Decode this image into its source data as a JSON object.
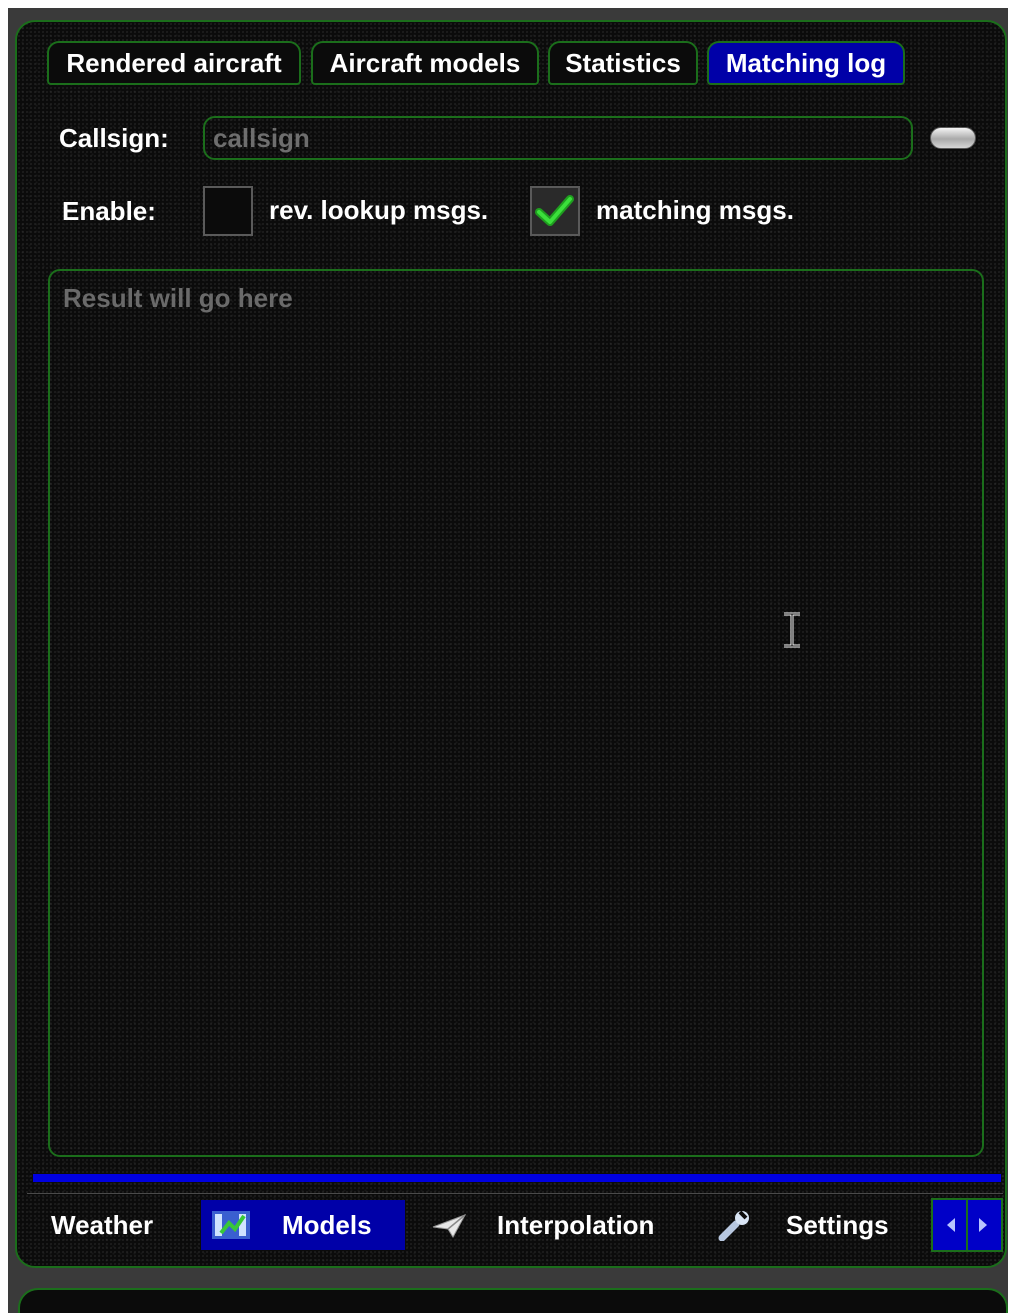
{
  "tabs": [
    {
      "label": "Rendered aircraft",
      "active": false
    },
    {
      "label": "Aircraft models",
      "active": false
    },
    {
      "label": "Statistics",
      "active": false
    },
    {
      "label": "Matching log",
      "active": true
    }
  ],
  "callsign": {
    "label": "Callsign:",
    "value": "",
    "placeholder": "callsign"
  },
  "enable": {
    "label": "Enable:",
    "options": [
      {
        "label": "rev. lookup msgs.",
        "checked": false
      },
      {
        "label": "matching msgs.",
        "checked": true
      }
    ]
  },
  "result": {
    "value": "",
    "placeholder": "Result will go here"
  },
  "bottom_nav": {
    "items": [
      {
        "label": "Weather",
        "icon": "none",
        "active": false
      },
      {
        "label": "Models",
        "icon": "models-icon",
        "active": true
      },
      {
        "label": "Interpolation",
        "icon": "paper-plane-icon",
        "active": false
      },
      {
        "label": "Settings",
        "icon": "wrench-icon",
        "active": false
      }
    ]
  },
  "colors": {
    "border": "#1b6e1b",
    "active_tab": "#0000a8",
    "splitter": "#0000e0",
    "check": "#22cc22",
    "placeholder": "#6e6e6e"
  }
}
